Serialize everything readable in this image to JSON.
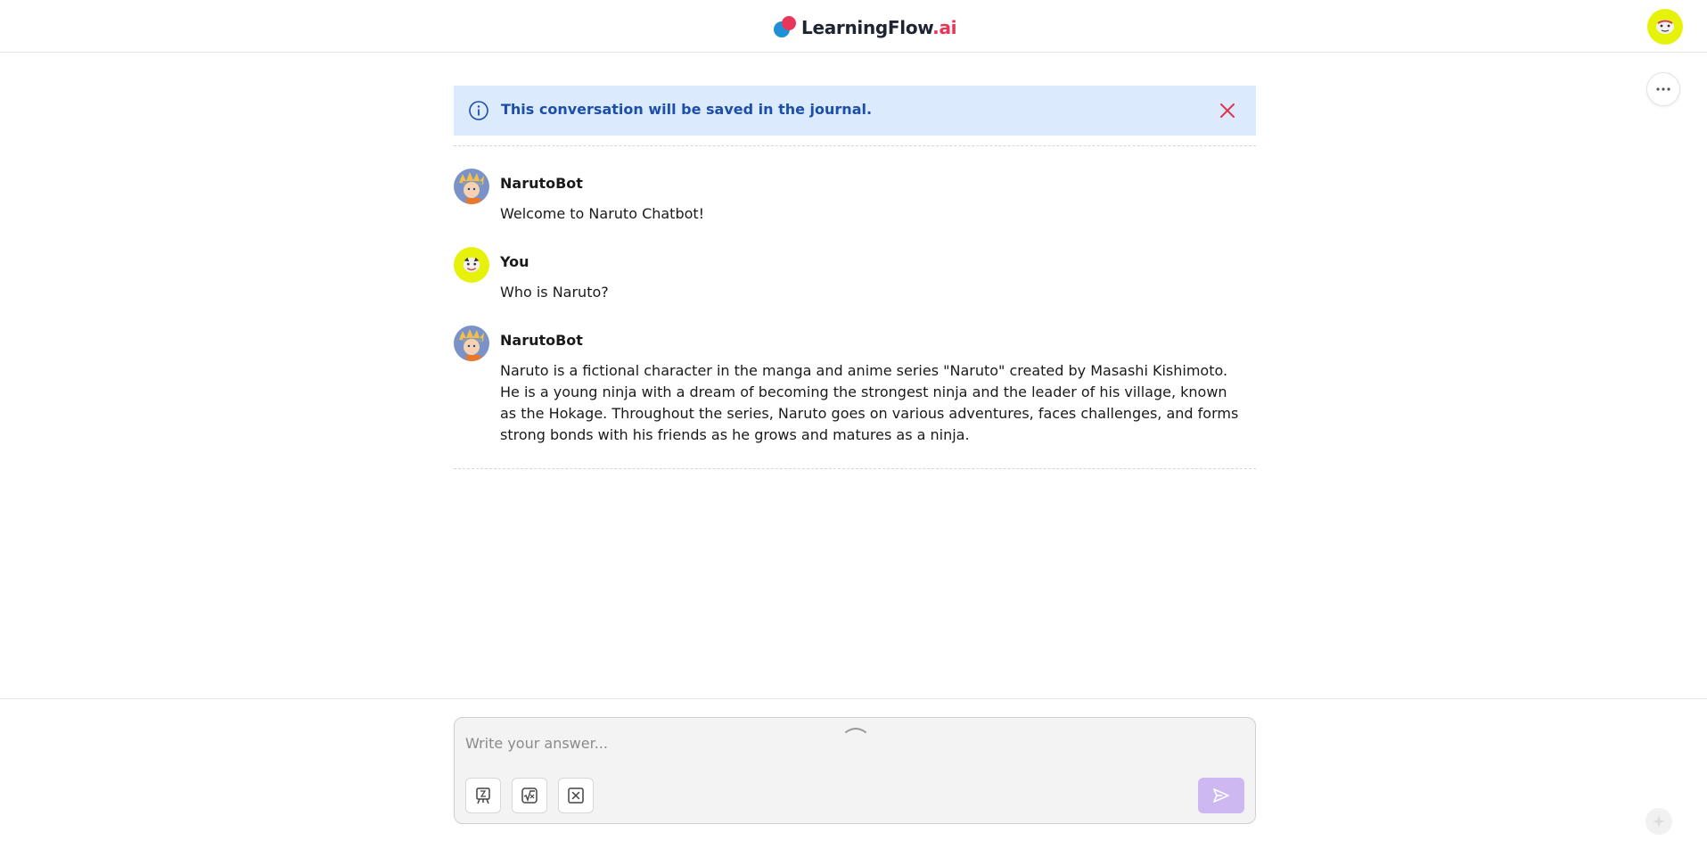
{
  "header": {
    "logo_main": "LearningFlow",
    "logo_accent": ".ai"
  },
  "notice": {
    "text": "This conversation will be saved in the journal."
  },
  "messages": [
    {
      "sender": "NarutoBot",
      "text": "Welcome to Naruto Chatbot!"
    },
    {
      "sender": "You",
      "text": "Who is Naruto?"
    },
    {
      "sender": "NarutoBot",
      "text": "Naruto is a fictional character in the manga and anime series \"Naruto\" created by Masashi Kishimoto. He is a young ninja with a dream of becoming the strongest ninja and the leader of his village, known as the Hokage. Throughout the series, Naruto goes on various adventures, faces challenges, and forms strong bonds with his friends as he grows and matures as a ninja."
    }
  ],
  "composer": {
    "placeholder": "Write your answer..."
  },
  "colors": {
    "brand_red": "#e8365a",
    "brand_blue": "#1e90d6",
    "notice_bg": "#dbeafc",
    "notice_text": "#1d4fa8",
    "user_avatar": "#e6f20a",
    "send_button": "#cdb8f2"
  },
  "icons": {
    "notice": "info-icon",
    "close": "close-icon",
    "more": "more-horizontal-icon",
    "tool_1": "whiteboard-icon",
    "tool_2": "math-formula-icon",
    "tool_3": "clear-box-icon",
    "send": "send-icon"
  }
}
